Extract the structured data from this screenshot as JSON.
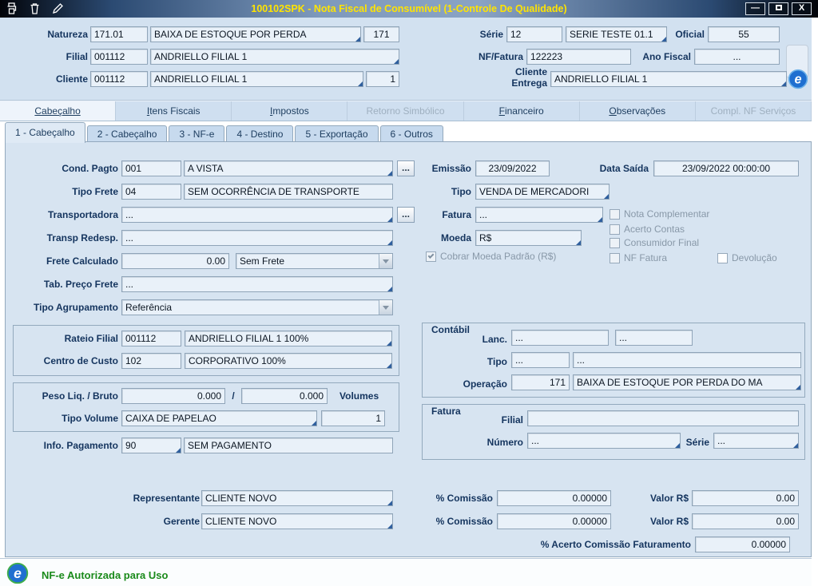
{
  "window": {
    "title": "100102SPK - Nota Fiscal de Consumível (1-Controle De Qualidade)",
    "min_glyph": "—",
    "close_glyph": "X"
  },
  "icons": {
    "nfe_letter": "e"
  },
  "misc": {
    "ellipsis": "...",
    "slash": "/"
  },
  "header": {
    "natureza_label": "Natureza",
    "natureza_code": "171.01",
    "natureza_desc": "BAIXA DE ESTOQUE POR PERDA",
    "natureza_num": "171",
    "serie_label": "Série",
    "serie_code": "12",
    "serie_desc": "SERIE TESTE 01.1",
    "oficial_label": "Oficial",
    "oficial_value": "55",
    "filial_label": "Filial",
    "filial_code": "001112",
    "filial_desc": "ANDRIELLO FILIAL 1",
    "nf_label": "NF/Fatura",
    "nf_value": "122223",
    "ano_label": "Ano Fiscal",
    "ano_value": "...",
    "cliente_label": "Cliente",
    "cliente_code": "001112",
    "cliente_desc": "ANDRIELLO FILIAL 1",
    "cliente_loja": "1",
    "entrega_label": "Cliente Entrega",
    "entrega_value": "ANDRIELLO FILIAL 1"
  },
  "tabs_main": [
    {
      "label": "Cabeçalho"
    },
    {
      "label": "Itens Fiscais"
    },
    {
      "label": "Impostos"
    },
    {
      "label": "Retorno Simbólico"
    },
    {
      "label": "Financeiro"
    },
    {
      "label": "Observações"
    },
    {
      "label": "Compl. NF Serviços"
    }
  ],
  "tabs_sub": [
    {
      "label": "1 - Cabeçalho"
    },
    {
      "label": "2 - Cabeçalho"
    },
    {
      "label": "3 - NF-e"
    },
    {
      "label": "4 - Destino"
    },
    {
      "label": "5 - Exportação"
    },
    {
      "label": "6 - Outros"
    }
  ],
  "form": {
    "cond_pagto_label": "Cond. Pagto",
    "cond_pagto_code": "001",
    "cond_pagto_desc": "A VISTA",
    "tipo_frete_label": "Tipo Frete",
    "tipo_frete_code": "04",
    "tipo_frete_desc": "SEM OCORRÊNCIA DE TRANSPORTE",
    "transportadora_label": "Transportadora",
    "transportadora_value": "...",
    "transp_redesp_label": "Transp Redesp.",
    "transp_redesp_value": "...",
    "frete_calculado_label": "Frete Calculado",
    "frete_calculado_value": "0.00",
    "frete_tipo_value": "Sem Frete",
    "tab_preco_label": "Tab. Preço Frete",
    "tab_preco_value": "...",
    "tipo_agrup_label": "Tipo Agrupamento",
    "tipo_agrup_value": "Referência",
    "rateio_filial_label": "Rateio Filial",
    "rateio_filial_code": "001112",
    "rateio_filial_desc": "ANDRIELLO FILIAL 1 100%",
    "centro_custo_label": "Centro de Custo",
    "centro_custo_code": "102",
    "centro_custo_desc": "CORPORATIVO 100%",
    "peso_label": "Peso Liq. / Bruto",
    "peso_liq": "0.000",
    "peso_bruto": "0.000",
    "volumes_label": "Volumes",
    "tipo_volume_label": "Tipo Volume",
    "tipo_volume_value": "CAIXA DE PAPELAO",
    "volume_qty": "1",
    "info_pag_label": "Info. Pagamento",
    "info_pag_code": "90",
    "info_pag_desc": "SEM PAGAMENTO",
    "emissao_label": "Emissão",
    "emissao_value": "23/09/2022",
    "data_saida_label": "Data Saída",
    "data_saida_value": "23/09/2022 00:00:00",
    "tipo_label": "Tipo",
    "tipo_value": "VENDA DE MERCADORI",
    "fatura_label": "Fatura",
    "fatura_value": "...",
    "moeda_label": "Moeda",
    "moeda_value": "R$",
    "chk_cobrar_label": "Cobrar Moeda Padrão (R$)",
    "chk_nota_complementar": "Nota Complementar",
    "chk_acerto_contas": "Acerto Contas",
    "chk_consumidor_final": "Consumidor Final",
    "chk_nf_fatura": "NF Fatura",
    "chk_devolucao": "Devolução"
  },
  "contabil": {
    "title": "Contábil",
    "lanc_label": "Lanc.",
    "lanc_v1": "...",
    "lanc_v2": "...",
    "tipo_label": "Tipo",
    "tipo_v1": "...",
    "tipo_v2": "...",
    "operacao_label": "Operação",
    "operacao_code": "171",
    "operacao_desc": "BAIXA DE ESTOQUE POR PERDA DO MA"
  },
  "fatura_box": {
    "title": "Fatura",
    "filial_label": "Filial",
    "filial_value": "",
    "numero_label": "Número",
    "numero_value": "...",
    "serie_label": "Série",
    "serie_value": "..."
  },
  "comissoes": {
    "representante_label": "Representante",
    "representante_value": "CLIENTE NOVO",
    "gerente_label": "Gerente",
    "gerente_value": "CLIENTE NOVO",
    "comissao_label": "% Comissão",
    "comissao_rep": "0.00000",
    "comissao_ger": "0.00000",
    "valor_label": "Valor R$",
    "valor_rep": "0.00",
    "valor_ger": "0.00",
    "acerto_label": "% Acerto Comissão Faturamento",
    "acerto_value": "0.00000"
  },
  "status": {
    "text": "NF-e Autorizada para Uso"
  }
}
